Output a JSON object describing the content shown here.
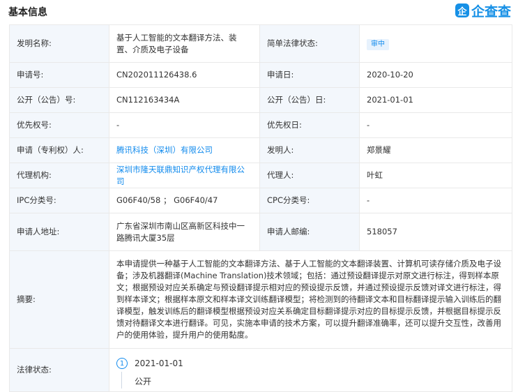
{
  "header": {
    "title": "基本信息",
    "brand_icon": "企",
    "brand_text": "企查查",
    "brand_color": "#128bed"
  },
  "rows": {
    "invention_name_label": "发明名称:",
    "invention_name": "基于人工智能的文本翻译方法、装置、介质及电子设备",
    "legal_status_simple_label": "简单法律状态:",
    "legal_status_simple": "审中",
    "app_no_label": "申请号:",
    "app_no": "CN202011126438.6",
    "app_date_label": "申请日:",
    "app_date": "2020-10-20",
    "pub_no_label": "公开（公告）号:",
    "pub_no": "CN112163434A",
    "pub_date_label": "公开（公告）日:",
    "pub_date": "2021-01-01",
    "priority_no_label": "优先权号:",
    "priority_no": "-",
    "priority_date_label": "优先权日:",
    "priority_date": "-",
    "applicant_label": "申请（专利权）人:",
    "applicant": "腾讯科技（深圳）有限公司",
    "inventor_label": "发明人:",
    "inventor": "郑景耀",
    "agency_label": "代理机构:",
    "agency": "深圳市隆天联鼎知识产权代理有限公司",
    "agent_label": "代理人:",
    "agent": "叶虹",
    "ipc_label": "IPC分类号:",
    "ipc": "G06F40/58 ； G06F40/47",
    "cpc_label": "CPC分类号:",
    "cpc": "-",
    "address_label": "申请人地址:",
    "address": "广东省深圳市南山区高新区科技中一路腾讯大厦35层",
    "postcode_label": "申请人邮编:",
    "postcode": "518057",
    "abstract_label": "摘要:",
    "abstract": "本申请提供一种基于人工智能的文本翻译方法、基于人工智能的文本翻译装置、计算机可读存储介质及电子设备；涉及机器翻译(Machine Translation)技术领域；包括：通过预设翻译提示对原文进行标注，得到样本原文；根据预设对应关系确定与预设翻译提示相对应的预设提示反馈，并通过预设提示反馈对译文进行标注，得到样本译文；根据样本原文和样本译文训练翻译模型；将检测到的待翻译文本和目标翻译提示输入训练后的翻译模型，触发训练后的翻译模型根据预设对应关系确定目标翻译提示对应的目标提示反馈，并根据目标提示反馈对待翻译文本进行翻译。可见，实施本申请的技术方案，可以提升翻译准确率，还可以提升交互性，改善用户的使用体验，提升用户的使用黏度。",
    "legal_status_label": "法律状态:",
    "timeline_index": "1",
    "timeline_date": "2021-01-01",
    "timeline_event": "公开"
  }
}
